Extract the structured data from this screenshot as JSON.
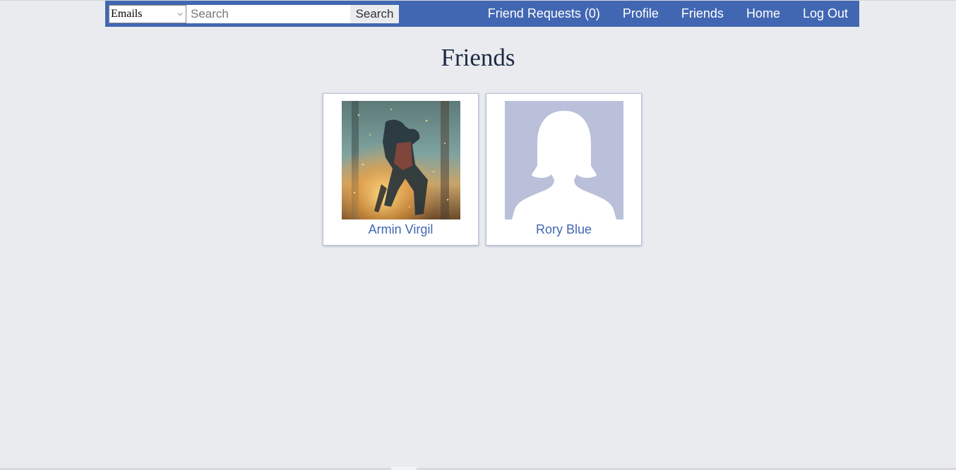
{
  "navbar": {
    "filter_select": {
      "selected": "Emails",
      "options": [
        "Emails"
      ]
    },
    "search": {
      "placeholder": "Search",
      "value": "",
      "button_label": "Search"
    },
    "links": [
      {
        "label": "Friend Requests (0)"
      },
      {
        "label": "Profile"
      },
      {
        "label": "Friends"
      },
      {
        "label": "Home"
      },
      {
        "label": "Log Out"
      }
    ]
  },
  "page": {
    "title": "Friends"
  },
  "friends": [
    {
      "name": "Armin Virgil",
      "avatar": "photo-avatar"
    },
    {
      "name": "Rory Blue",
      "avatar": "default-silhouette-avatar"
    }
  ],
  "colors": {
    "navbar_bg": "#4267b2",
    "page_bg": "#e9ebee",
    "link_color": "#4267b2",
    "title_color": "#1d2a44",
    "silhouette_bg": "#bac0da"
  }
}
